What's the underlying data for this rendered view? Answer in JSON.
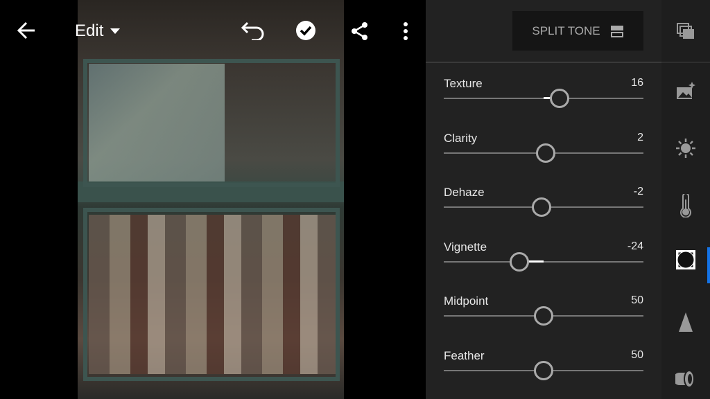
{
  "topbar": {
    "back_icon": "arrow-left-icon",
    "mode_label": "Edit",
    "undo_icon": "undo-icon",
    "done_icon": "check-circle-icon",
    "share_icon": "share-icon",
    "more_icon": "more-vertical-icon"
  },
  "panel": {
    "section_button": "SPLIT TONE",
    "sliders": [
      {
        "label": "Texture",
        "value": "16",
        "num": 16,
        "min": -100,
        "max": 100
      },
      {
        "label": "Clarity",
        "value": "2",
        "num": 2,
        "min": -100,
        "max": 100
      },
      {
        "label": "Dehaze",
        "value": "-2",
        "num": -2,
        "min": -100,
        "max": 100
      },
      {
        "label": "Vignette",
        "value": "-24",
        "num": -24,
        "min": -100,
        "max": 100
      },
      {
        "label": "Midpoint",
        "value": "50",
        "num": 50,
        "min": 0,
        "max": 100
      },
      {
        "label": "Feather",
        "value": "50",
        "num": 50,
        "min": 0,
        "max": 100
      }
    ]
  },
  "rail": {
    "items": [
      "presets-icon",
      "auto-icon",
      "light-icon",
      "color-icon",
      "effects-icon",
      "detail-icon",
      "optics-icon"
    ],
    "active": "effects-icon",
    "accent": "#1473e6"
  }
}
